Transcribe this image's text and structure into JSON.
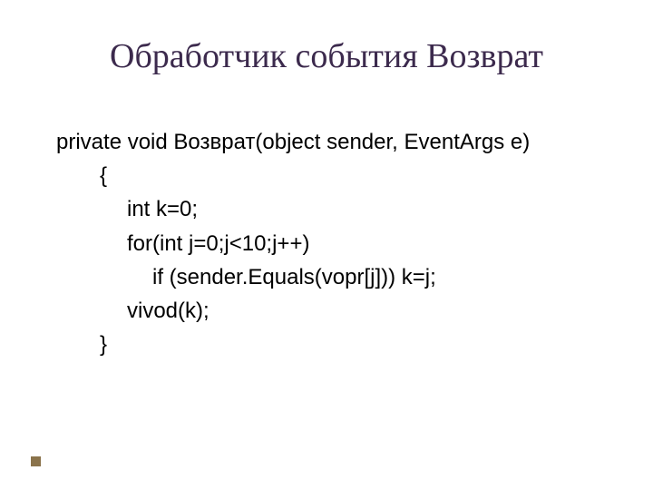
{
  "title": "Обработчик события Возврат",
  "code": {
    "l1": "private void Возврат(object sender, EventArgs e)",
    "l2": "{",
    "l3": "int k=0;",
    "l4": "for(int j=0;j<10;j++)",
    "l5": "if (sender.Equals(vopr[j])) k=j;",
    "l6": "vivod(k);",
    "l7": "}"
  }
}
